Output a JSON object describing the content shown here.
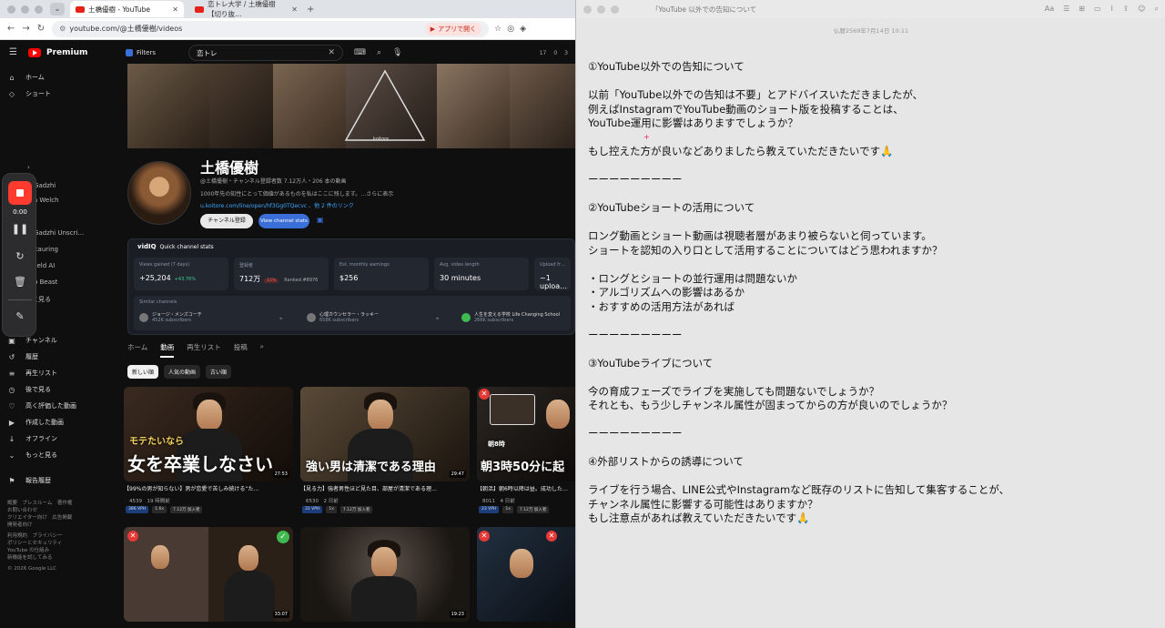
{
  "browser": {
    "tabs": [
      {
        "title": "土橋優樹 - YouTube"
      },
      {
        "title": "恋トレ大学 / 土橋優樹【切り抜…"
      }
    ],
    "new_tab": "+",
    "url": "youtube.com/@土橋優樹/videos",
    "open_in_app": "アプリで開く"
  },
  "youtube": {
    "logo": "Premium",
    "sidebar_top": [
      {
        "label": "ホーム",
        "icon": "home-icon"
      },
      {
        "label": "ショート",
        "icon": "shorts-icon"
      }
    ],
    "subscriptions": [
      "m Gadzhi",
      "dan Welch",
      "a",
      "m Gadzhi Unscri…",
      "y Stauring",
      "gsfield AI",
      "y to Beast",
      "っと見る"
    ],
    "you_items": [
      {
        "label": "チャンネル",
        "icon": "channel-icon"
      },
      {
        "label": "履歴",
        "icon": "history-icon"
      },
      {
        "label": "再生リスト",
        "icon": "playlist-icon"
      },
      {
        "label": "後で見る",
        "icon": "clock-icon"
      },
      {
        "label": "高く評価した動画",
        "icon": "like-icon"
      },
      {
        "label": "作成した動画",
        "icon": "video-icon"
      },
      {
        "label": "オフライン",
        "icon": "download-icon"
      },
      {
        "label": "もっと見る",
        "icon": "chevron-down-icon"
      }
    ],
    "report_history": "報告履歴",
    "footer_lines": [
      "概要　プレスルーム　著作権",
      "お問い合わせ",
      "クリエイター向け　広告掲載",
      "開発者向け",
      "",
      "利用規約　プライバシー",
      "ポリシーとセキュリティ",
      "YouTube の仕組み",
      "新機能を試してみる",
      "",
      "© 2026 Google LLC"
    ],
    "filters_label": "Filters",
    "search_query": "恋トレ",
    "top_right": [
      "17",
      "0",
      "3"
    ],
    "banner_brand": "koitore",
    "channel": {
      "name": "土橋優樹",
      "meta": "@土橋優樹・チャンネル登録者数 7.12万人・206 本の動画",
      "description": "1000年先の知性にとって価値があるものを私はここに残します。…さらに表示",
      "link": "u.koitore.com/line/open/hf3Gg0TQecvc 、他 2 件のリンク",
      "subscribe": "チャンネル登録",
      "view_stats": "View channel stats"
    },
    "vidiq": {
      "brand": "vidIQ",
      "title": "Quick channel stats",
      "stats": [
        {
          "label": "Views gained (7 days)",
          "value": "+25,204",
          "extra": "+43.76%"
        },
        {
          "label": "登録者",
          "value": "712万",
          "extra": "15%",
          "rank": "Ranked #8976"
        },
        {
          "label": "Est. monthly earnings",
          "value": "$256"
        },
        {
          "label": "Avg. video length",
          "value": "30 minutes"
        },
        {
          "label": "Upload fr…",
          "value": "~1 uploa…"
        }
      ],
      "similar_label": "Similar channels",
      "similar": [
        {
          "name": "ジョージ・メンズコーチ",
          "subs": "452K subscribers"
        },
        {
          "name": "心理カウンセラー・ラッキー",
          "subs": "658K subscribers"
        },
        {
          "name": "人生を変える学校 Life Changing School",
          "subs": "266K subscribers"
        }
      ]
    },
    "tabs": [
      "ホーム",
      "動画",
      "再生リスト",
      "投稿"
    ],
    "active_tab": "動画",
    "chips": [
      "新しい順",
      "人気の動画",
      "古い順"
    ],
    "videos": [
      {
        "caption_small": "モテたいなら",
        "caption": "女を卒業しなさい",
        "duration": "27:53",
        "title": "【99%の男が知らない】男が恋愛で苦しみ続ける“た…",
        "meta": "4539　19 時間前",
        "vph": "386 VPH",
        "mult": "1.6x",
        "views": "7.12万 加入者"
      },
      {
        "caption": "強い男は清潔である理由",
        "duration": "29:47",
        "title": "【見る力】強者男性ほど見た目、部屋が清潔である理…",
        "meta": "6530　2 日前",
        "vph": "31 VPH",
        "mult": "1x",
        "views": "7.12万 加入者"
      },
      {
        "caption_small": "朝8時",
        "caption": "朝3時50分に起",
        "duration": "",
        "title": "【朝活】朝6時以降は昼。成功した…",
        "meta": "8011　4 日前",
        "vph": "23 VPH",
        "mult": "1x",
        "views": "7.12万 加入者"
      },
      {
        "duration": "33:07"
      },
      {
        "duration": "19:23"
      },
      {
        "duration": ""
      }
    ]
  },
  "recorder": {
    "time": "0:00"
  },
  "notes": {
    "window_title": "「YouTube 以外での告知について",
    "date": "仏暦2569年7月14日 10:11",
    "lines": [
      "①YouTube以外での告知について",
      "",
      "以前「YouTube以外での告知は不要」とアドバイスいただきましたが、",
      "例えばInstagramでYouTube動画のショート版を投稿することは、",
      "YouTube運用に影響はありますでしょうか？",
      "",
      "もし控えた方が良いなどありましたら教えていただきたいです🙏",
      "",
      "ーーーーーーーーー",
      "",
      "②YouTubeショートの活用について",
      "",
      "ロング動画とショート動画は視聴者層があまり被らないと伺っています。",
      "ショートを認知の入り口として活用することについてはどう思われますか？",
      "",
      "・ロングとショートの並行運用は問題ないか",
      "・アルゴリズムへの影響はあるか",
      "・おすすめの活用方法があれば",
      "",
      "ーーーーーーーーー",
      "",
      "③YouTubeライブについて",
      "",
      "今の育成フェーズでライブを実施しても問題ないでしょうか？",
      "それとも、もう少しチャンネル属性が固まってからの方が良いのでしょうか？",
      "",
      "ーーーーーーーーー",
      "",
      "④外部リストからの誘導について",
      "",
      "ライブを行う場合、LINE公式やInstagramなど既存のリストに告知して集客することが、",
      "チャンネル属性に影響する可能性はありますか？",
      "もし注意点があれば教えていただきたいです🙏"
    ]
  },
  "colors": {
    "youtube_red": "#ff0000",
    "link_blue": "#3ea6ff",
    "stop_red": "#ff3b30",
    "notes_bg": "#e6e6e6"
  }
}
